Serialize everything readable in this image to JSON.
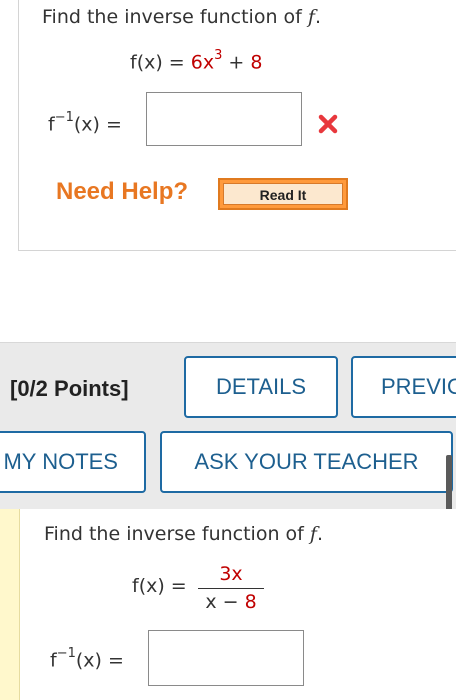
{
  "question1": {
    "prompt": "Find the inverse function of f.",
    "function_lhs": "f(x) = ",
    "function_coef": "6x",
    "function_exp": "3",
    "function_op": " + ",
    "function_const": "8",
    "inverse_label": "f",
    "inverse_sup": "−1",
    "inverse_rest": "(x) =",
    "answer_value": "",
    "need_help": "Need Help?",
    "read_it": "Read It",
    "status_color": "#e8383d"
  },
  "question_header": {
    "points": "[0/2 Points]",
    "details_label": "DETAILS",
    "previous_label": "PREVIO",
    "my_notes_label": "MY NOTES",
    "ask_teacher_label": "ASK YOUR TEACHER"
  },
  "question2": {
    "prompt": "Find the inverse function of f.",
    "function_lhs": "f(x) = ",
    "numerator": "3x",
    "denominator_var": "x − ",
    "denominator_const": "8",
    "inverse_label": "f",
    "inverse_sup": "−1",
    "inverse_rest": "(x) =",
    "answer_value": ""
  },
  "colors": {
    "accent_blue": "#1e6aa3",
    "help_orange": "#e87722",
    "value_red": "#c00000"
  }
}
